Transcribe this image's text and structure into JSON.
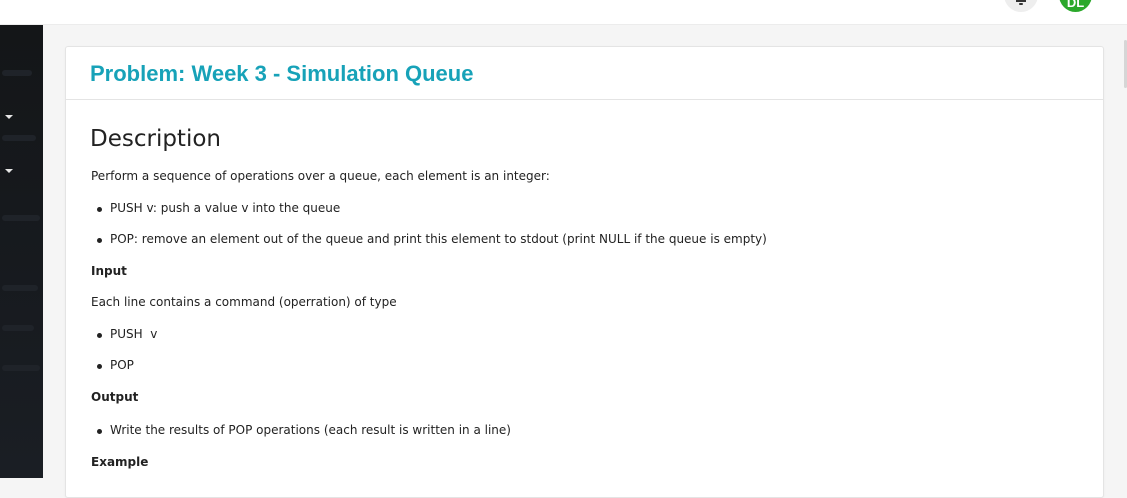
{
  "header": {
    "avatar_initials": "DL",
    "avatar_color": "#2aa82a"
  },
  "sidebar": {
    "background": "#16191d"
  },
  "problem": {
    "title": "Problem: Week 3 - Simulation Queue",
    "title_color": "#17a2b8",
    "description_heading": "Description",
    "intro": "Perform a sequence of operations over a queue, each element is an integer:",
    "operations": [
      "PUSH v: push a value v into the queue",
      "POP: remove an element out of the queue and print this element to stdout (print NULL if the queue is empty)"
    ],
    "input_label": "Input",
    "input_text": "Each line contains a command (operration) of type",
    "input_commands": [
      "PUSH  v",
      "POP"
    ],
    "output_label": "Output",
    "output_items": [
      "Write the results of POP operations (each result is written in a line)"
    ],
    "example_label": "Example"
  }
}
